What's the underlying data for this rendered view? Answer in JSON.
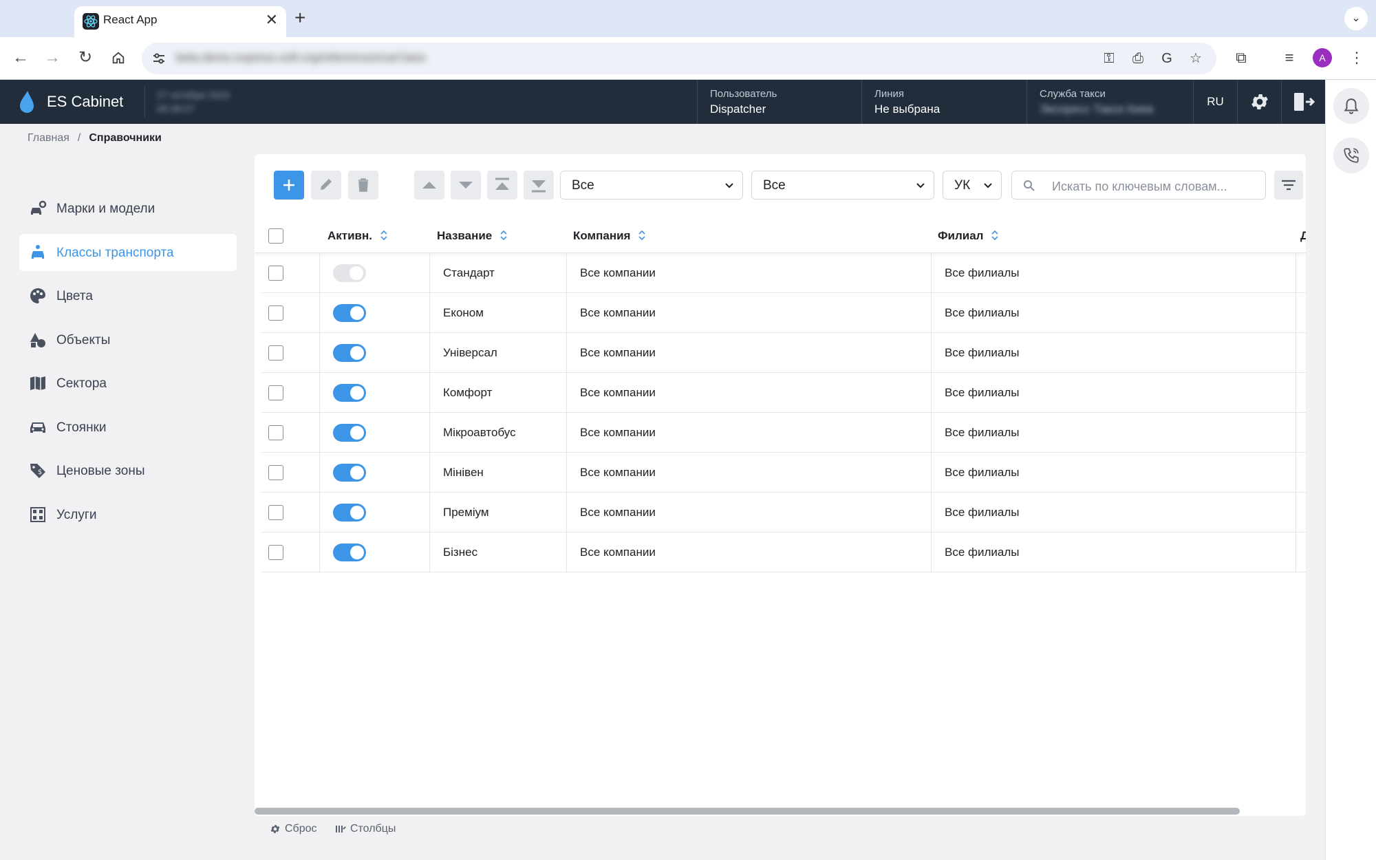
{
  "browser": {
    "tab_title": "React App",
    "url": "beta.demo.express-soft.org/references/carClass"
  },
  "header": {
    "brand": "ES Cabinet",
    "blurred_lines": [
      "27 октября 2024",
      "09:38:07"
    ],
    "user_label": "Пользователь",
    "user_value": "Dispatcher",
    "line_label": "Линия",
    "line_value": "Не выбрана",
    "taxi_label": "Служба такси",
    "taxi_value": "Экспресс Такси Киев",
    "lang": "RU"
  },
  "breadcrumb": {
    "home": "Главная",
    "separator": "/",
    "current": "Справочники"
  },
  "sidebar": {
    "items": [
      {
        "label": "Марки и модели",
        "icon": "car-gear-icon"
      },
      {
        "label": "Классы транспорта",
        "icon": "car-class-icon",
        "active": true
      },
      {
        "label": "Цвета",
        "icon": "palette-icon"
      },
      {
        "label": "Объекты",
        "icon": "shapes-icon"
      },
      {
        "label": "Сектора",
        "icon": "map-icon"
      },
      {
        "label": "Стоянки",
        "icon": "car-front-icon"
      },
      {
        "label": "Ценовые зоны",
        "icon": "price-tag-icon"
      },
      {
        "label": "Услуги",
        "icon": "services-grid-icon"
      }
    ]
  },
  "toolbar": {
    "filter1": "Все",
    "filter2": "Все",
    "filter3": "УК",
    "search_placeholder": "Искать по ключевым словам..."
  },
  "table": {
    "columns": [
      "Активн.",
      "Название",
      "Компания",
      "Филиал",
      "Д"
    ],
    "rows": [
      {
        "active": false,
        "name": "Стандарт",
        "company": "Все компании",
        "branch": "Все филиалы"
      },
      {
        "active": true,
        "name": "Економ",
        "company": "Все компании",
        "branch": "Все филиалы"
      },
      {
        "active": true,
        "name": "Універсал",
        "company": "Все компании",
        "branch": "Все филиалы"
      },
      {
        "active": true,
        "name": "Комфорт",
        "company": "Все компании",
        "branch": "Все филиалы"
      },
      {
        "active": true,
        "name": "Мікроавтобус",
        "company": "Все компании",
        "branch": "Все филиалы"
      },
      {
        "active": true,
        "name": "Мінівен",
        "company": "Все компании",
        "branch": "Все филиалы"
      },
      {
        "active": true,
        "name": "Преміум",
        "company": "Все компании",
        "branch": "Все филиалы"
      },
      {
        "active": true,
        "name": "Бізнес",
        "company": "Все компании",
        "branch": "Все филиалы"
      }
    ]
  },
  "footer": {
    "reset": "Сброс",
    "columns": "Столбцы"
  },
  "colors": {
    "accent": "#3d95e7",
    "header_bg": "#222d3b",
    "page_bg": "#f1f1f3"
  }
}
